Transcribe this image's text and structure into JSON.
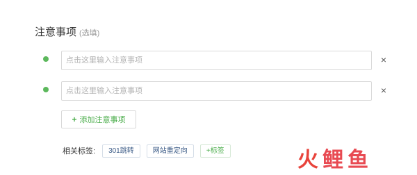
{
  "section": {
    "title": "注意事项",
    "optional_hint": "(选填)"
  },
  "notes": [
    {
      "placeholder": "点击这里输入注意事项",
      "value": ""
    },
    {
      "placeholder": "点击这里输入注意事项",
      "value": ""
    }
  ],
  "remove_icon": "×",
  "add_button": {
    "label": "添加注意事项",
    "icon": "+"
  },
  "tags": {
    "label": "相关标签:",
    "items": [
      "301跳转",
      "网站重定向"
    ],
    "add_label": "+标签"
  },
  "watermark": {
    "chars": [
      "火",
      "鲤",
      "鱼"
    ]
  },
  "colors": {
    "accent": "#5cb85c",
    "tag_text": "#3a5a86",
    "watermark": "#e8433b"
  }
}
